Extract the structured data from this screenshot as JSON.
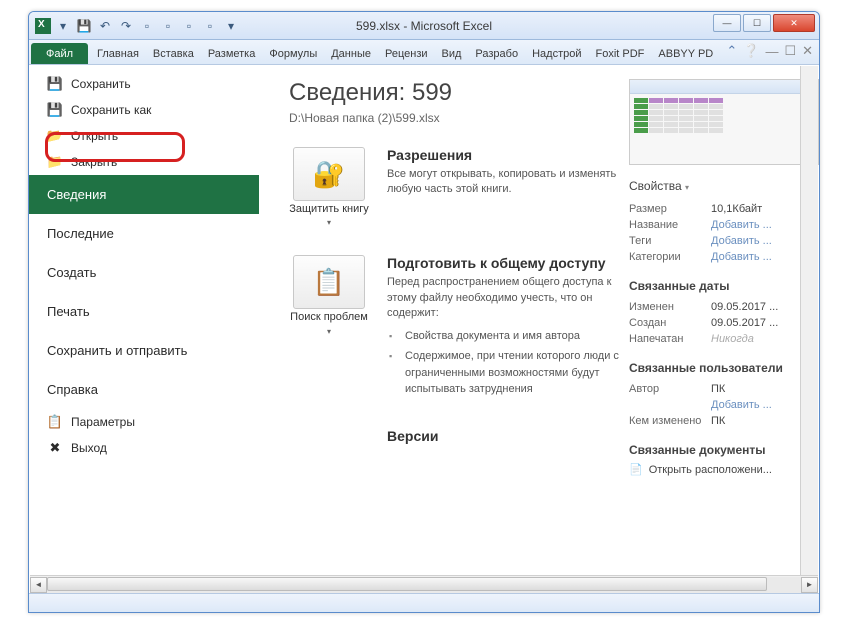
{
  "titlebar": {
    "title": "599.xlsx - Microsoft Excel"
  },
  "win_controls": {
    "min": "—",
    "max": "☐",
    "close": "✕"
  },
  "ribbon": {
    "file": "Файл",
    "tabs": [
      "Главная",
      "Вставка",
      "Разметка",
      "Формулы",
      "Данные",
      "Рецензи",
      "Вид",
      "Разрабо",
      "Надстрой",
      "Foxit PDF",
      "ABBYY PD"
    ]
  },
  "backstage_left": {
    "save": "Сохранить",
    "save_as": "Сохранить как",
    "open": "Открыть",
    "close": "Закрыть",
    "info": "Сведения",
    "recent": "Последние",
    "new": "Создать",
    "print": "Печать",
    "save_send": "Сохранить и отправить",
    "help": "Справка",
    "options": "Параметры",
    "exit": "Выход"
  },
  "info": {
    "title": "Сведения: 599",
    "path": "D:\\Новая папка (2)\\599.xlsx",
    "protect_btn": "Защитить книгу",
    "check_btn": "Поиск проблем",
    "perm_title": "Разрешения",
    "perm_text": "Все могут открывать, копировать и изменять любую часть этой книги.",
    "prep_title": "Подготовить к общему доступу",
    "prep_text": "Перед распространением общего доступа к этому файлу необходимо учесть, что он содержит:",
    "prep_item1": "Свойства документа и имя автора",
    "prep_item2": "Содержимое, при чтении которого люди с ограниченными возможностями будут испытывать затруднения",
    "versions_title": "Версии"
  },
  "props": {
    "header": "Свойства",
    "size_l": "Размер",
    "size_v": "10,1Кбайт",
    "title_l": "Название",
    "title_v": "Добавить ...",
    "tags_l": "Теги",
    "tags_v": "Добавить ...",
    "cat_l": "Категории",
    "cat_v": "Добавить ...",
    "dates_title": "Связанные даты",
    "mod_l": "Изменен",
    "mod_v": "09.05.2017 ...",
    "created_l": "Создан",
    "created_v": "09.05.2017 ...",
    "printed_l": "Напечатан",
    "printed_v": "Никогда",
    "users_title": "Связанные пользователи",
    "author_l": "Автор",
    "author_v": "ПК",
    "add_author": "Добавить ...",
    "lastmod_l": "Кем изменено",
    "lastmod_v": "ПК",
    "docs_title": "Связанные документы",
    "open_loc": "Открыть расположени..."
  }
}
